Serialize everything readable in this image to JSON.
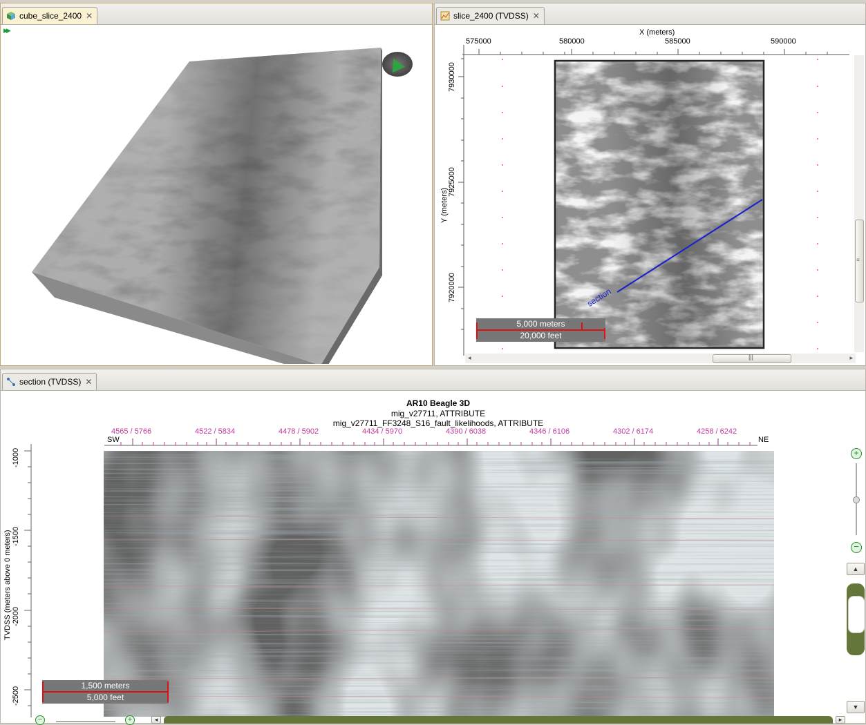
{
  "cube_panel": {
    "tab_label": "cube_slice_2400"
  },
  "slice_panel": {
    "tab_label": "slice_2400 (TVDSS)",
    "x_axis_label": "X (meters)",
    "x_ticks": [
      "575000",
      "580000",
      "585000",
      "590000"
    ],
    "y_axis_label": "Y (meters)",
    "y_ticks": [
      "7930000",
      "7925000",
      "7920000"
    ],
    "section_label": "section",
    "scale_meters": "5,000 meters",
    "scale_feet": "20,000 feet"
  },
  "section_panel": {
    "tab_label": "section (TVDSS)",
    "title": "AR10 Beagle 3D",
    "subtitle1": "mig_v27711, ATTRIBUTE",
    "subtitle2": "mig_v27711_FF3248_S16_fault_likelihoods, ATTRIBUTE",
    "trace_labels": [
      "4565 / 5766",
      "4522 / 5834",
      "4478 / 5902",
      "4434 / 5970",
      "4390 / 6038",
      "4346 / 6106",
      "4302 / 6174",
      "4258 / 6242"
    ],
    "left_end": "SW",
    "right_end": "NE",
    "y_axis_label": "TVDSS (meters above 0 meters)",
    "y_ticks": [
      "-1000",
      "-1500",
      "-2000",
      "-2500"
    ],
    "scale_meters": "1,500 meters",
    "scale_feet": "5,000 feet"
  },
  "colors": {
    "trace_label": "#c0399c",
    "section_line": "#1a24c8",
    "scale_bar": "#e01010",
    "active_tab": "#fbf2d4"
  }
}
